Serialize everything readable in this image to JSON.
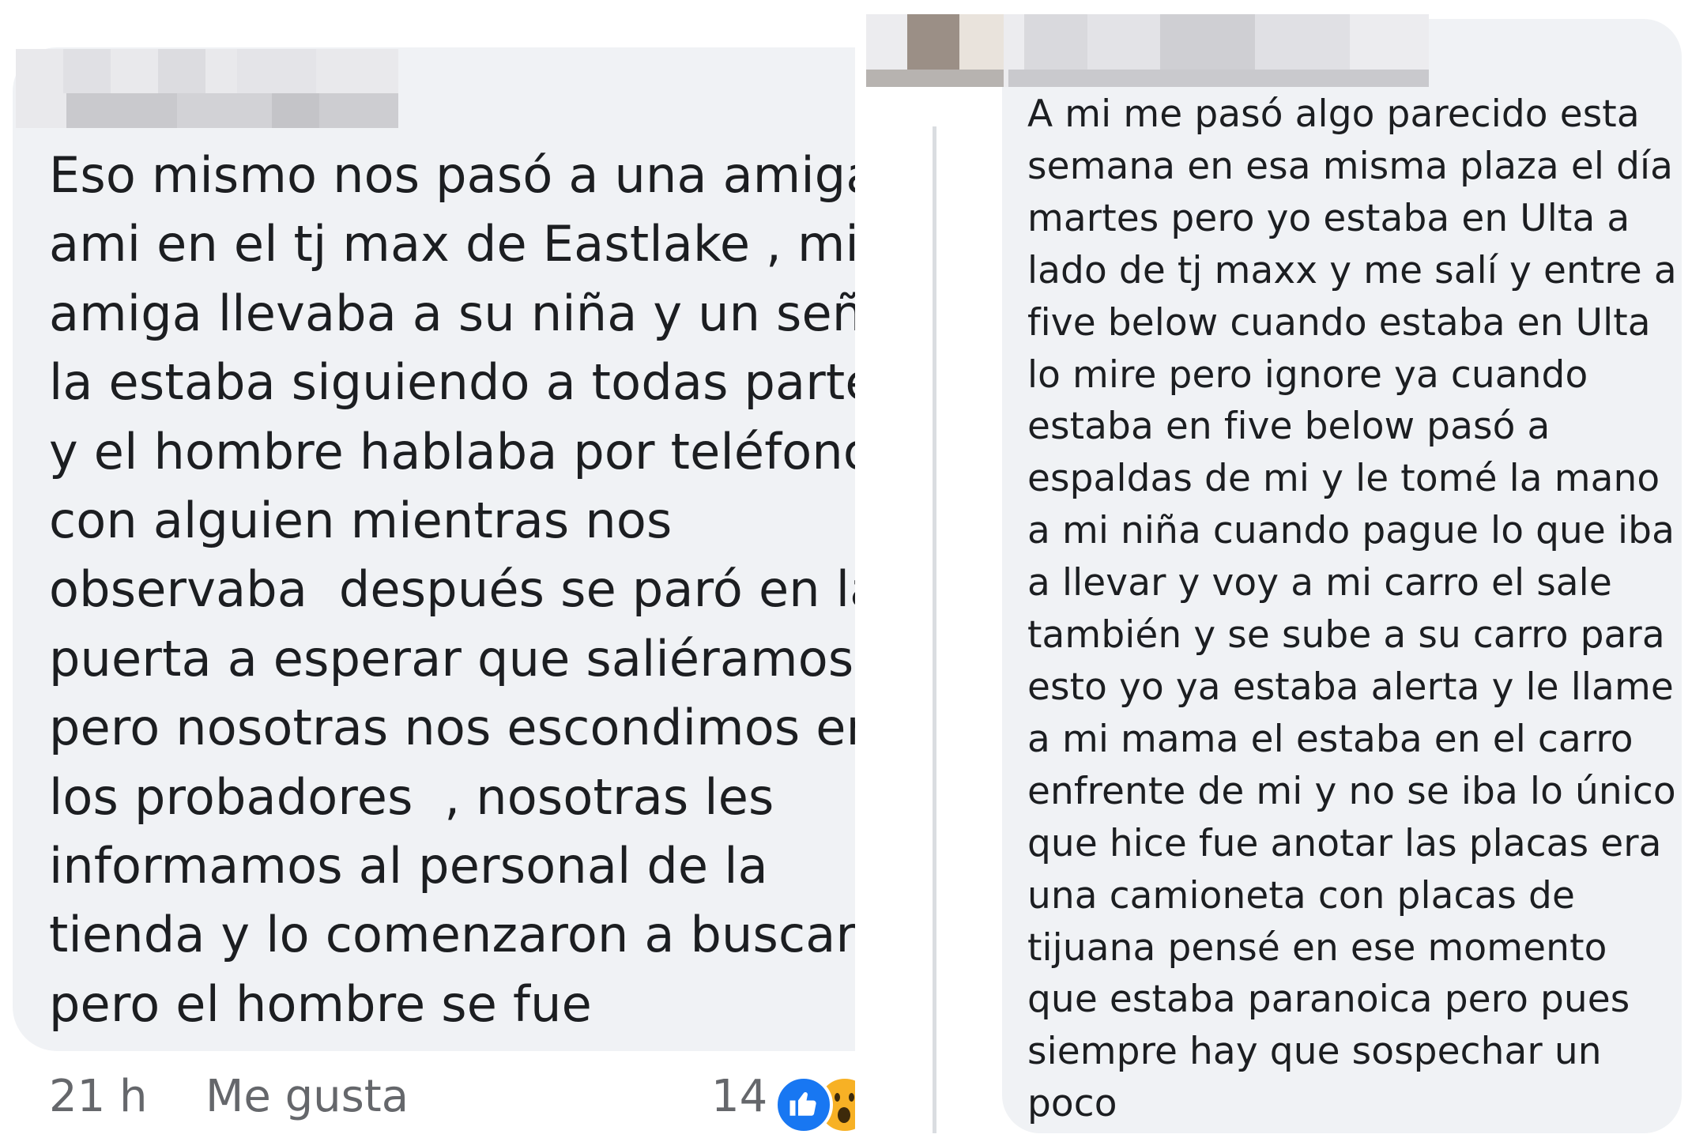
{
  "left_comment": {
    "author_name": "",
    "text": "Eso mismo nos pasó a una amiga y\nami en el tj max de Eastlake , mi\namiga llevaba a su niña y un señor\nla estaba siguiendo a todas partes\ny el hombre hablaba por teléfono\ncon alguien mientras nos\nobservaba  después se paró en la\npuerta a esperar que saliéramos\npero nosotras nos escondimos en\nlos probadores  , nosotras les\ninformamos al personal de la\ntienda y lo comenzaron a buscar\npero el hombre se fue",
    "time": "21 h",
    "like_label": "Me gusta",
    "reaction_count": "14",
    "reactions": [
      "like-icon",
      "wow-icon"
    ]
  },
  "right_comment": {
    "author_name": "",
    "text": "A mi me pasó algo parecido esta\nsemana en esa misma plaza el día\nmartes pero yo estaba en Ulta a\nlado de tj maxx y me salí y entre a\nfive below cuando estaba en Ulta\nlo mire pero ignore ya cuando\nestaba en five below pasó a\nespaldas de mi y le tomé la mano\na mi niña cuando pague lo que iba\na llevar y voy a mi carro el sale\ntambién y se sube a su carro para\nesto yo ya estaba alerta y le llame\na mi mama el estaba en el carro\nenfrente de mi y no se iba lo único\nque hice fue anotar las placas era\nuna camioneta con placas de\ntijuana pensé en ese momento\nque estaba paranoica pero pues\nsiempre hay que sospechar un\npoco"
  },
  "colors": {
    "bubble": "#f0f2f5",
    "text": "#1c1e21",
    "meta": "#65676b",
    "like_blue": "#1877f2",
    "wow_yellow": "#f7b125"
  }
}
